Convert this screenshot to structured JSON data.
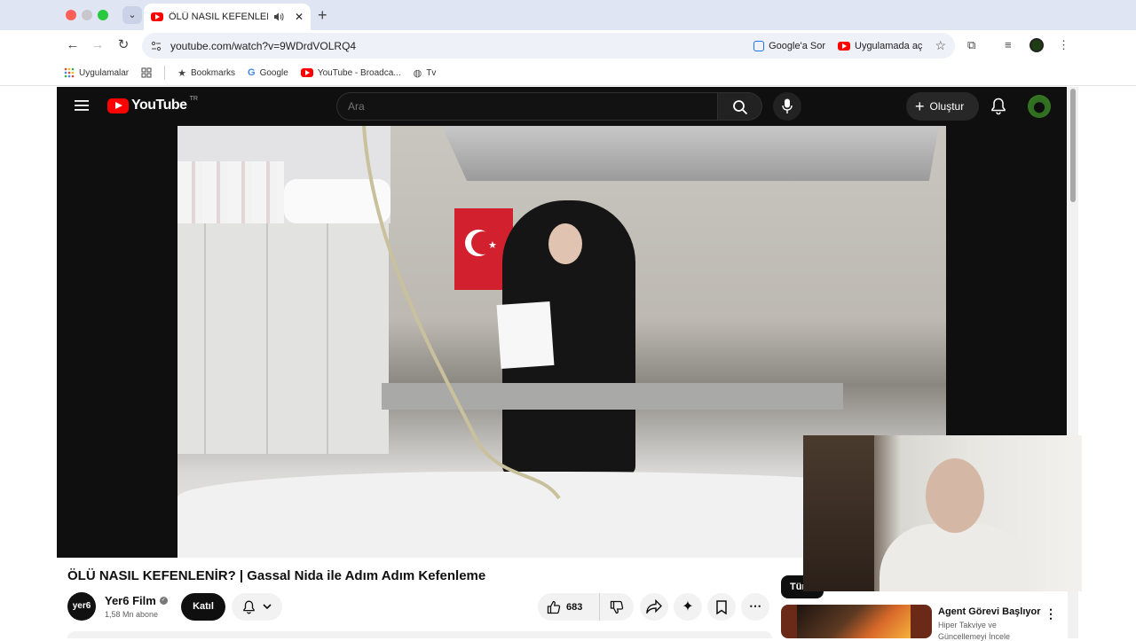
{
  "browser": {
    "tab": {
      "title": "ÖLÜ NASIL KEFENLENİR? | Gassal Nida ile Adım Adım Kefenleme"
    },
    "url": "youtube.com/watch?v=9WDrdVOLRQ4",
    "omnibox_actions": {
      "ask_google": "Google'a Sor",
      "open_in_app": "Uygulamada aç"
    },
    "bookmarks": {
      "apps": "Uygulamalar",
      "bookmarks": "Bookmarks",
      "google": "Google",
      "youtube": "YouTube - Broadca...",
      "tv": "Tv"
    }
  },
  "youtube": {
    "logo_text": "YouTube",
    "country_code": "TR",
    "search_placeholder": "Ara",
    "create_label": "Oluştur"
  },
  "video": {
    "title": "ÖLÜ NASIL KEFENLENİR? | Gassal Nida ile Adım Adım Kefenleme",
    "channel": {
      "name": "Yer6 Film",
      "subscribers": "1,58 Mn abone",
      "avatar_text": "yer6"
    },
    "join_label": "Katıl",
    "likes": "683"
  },
  "sidebar": {
    "chip_label": "Tür",
    "recommendation": {
      "title": "Agent Görevi Başlıyor",
      "subtitle_line1": "Hiper Takviye ve",
      "subtitle_line2": "Güncellemeyi İncele"
    }
  },
  "colors": {
    "youtube_red": "#ff0000",
    "chrome_tab_bg": "#dfe5f2",
    "omnibox_bg": "#eef1f8",
    "yt_dark": "#0f0f0f"
  }
}
